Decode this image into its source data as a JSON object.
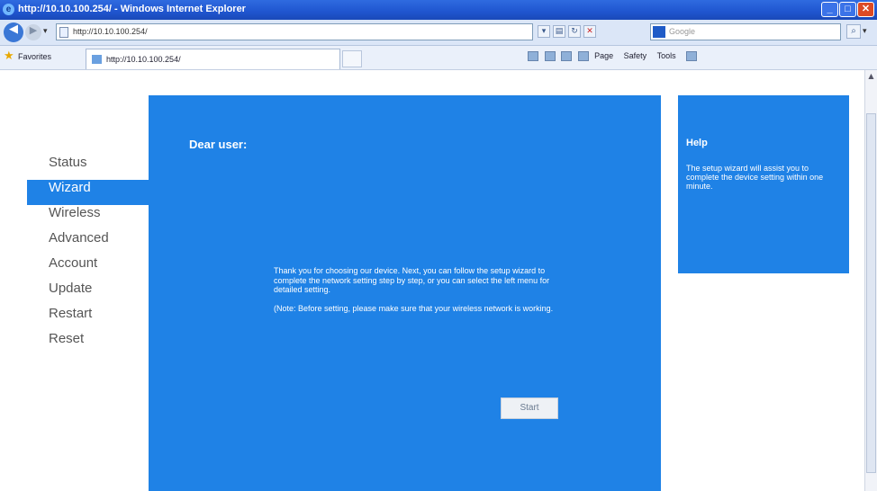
{
  "window": {
    "title": "http://10.10.100.254/ - Windows Internet Explorer",
    "ie_logo": "e",
    "min_glyph": "_",
    "max_glyph": "□",
    "close_glyph": "✕"
  },
  "addressbar": {
    "back_glyph": "◀",
    "forward_glyph": "▶",
    "dropdown_glyph": "▾",
    "url": "http://10.10.100.254/",
    "search_placeholder": "Google",
    "search_glyph": "⌕"
  },
  "favorites": {
    "label": "Favorites",
    "star_glyph": "★",
    "tab_title": "http://10.10.100.254/",
    "commands": [
      "Page",
      "Safety",
      "Tools"
    ]
  },
  "sidebar": {
    "items": [
      {
        "label": "Status"
      },
      {
        "label": "Wizard"
      },
      {
        "label": "Wireless"
      },
      {
        "label": "Advanced"
      },
      {
        "label": "Account"
      },
      {
        "label": "Update"
      },
      {
        "label": "Restart"
      },
      {
        "label": "Reset"
      }
    ],
    "active": "Wizard"
  },
  "main": {
    "greeting": "Dear user:",
    "paragraph1": "Thank you for choosing our device. Next, you can follow the setup wizard to complete the network setting step by step, or you can select the left menu for detailed setting.",
    "paragraph2": "(Note: Before setting, please make sure that your wireless network is working.",
    "start_label": "Start"
  },
  "help": {
    "title": "Help",
    "text": "The setup wizard will assist you to complete the device setting within one minute."
  },
  "colors": {
    "panel_blue": "#1f82e6",
    "nav_text": "#555555"
  }
}
